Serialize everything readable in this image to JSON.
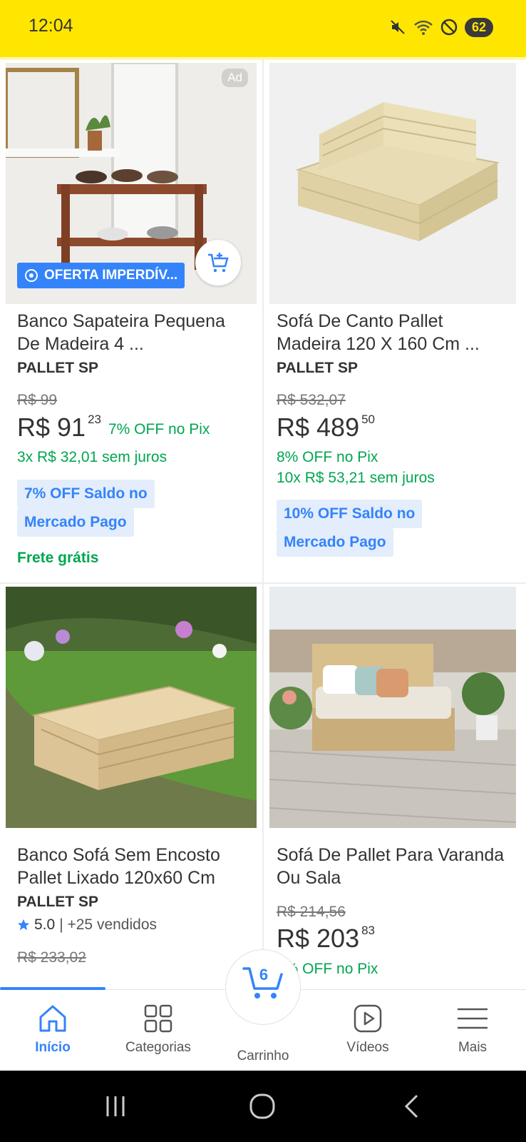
{
  "status_bar": {
    "time": "12:04",
    "battery": "62"
  },
  "products": [
    {
      "ad": "Ad",
      "offer_badge": "OFERTA IMPERDÍV...",
      "title": "Banco Sapateira Pequena De Madeira 4 ...",
      "brand": "PALLET SP",
      "old_price": "R$ 99",
      "price_int": "R$ 91",
      "price_cents": "23",
      "pix_discount": "7% OFF no Pix",
      "installments": "3x R$ 32,01 sem juros",
      "promo_line1": "7% OFF Saldo no",
      "promo_line2": "Mercado Pago",
      "shipping": "Frete grátis"
    },
    {
      "title": "Sofá De Canto Pallet Madeira 120 X 160 Cm ...",
      "brand": "PALLET SP",
      "old_price": "R$ 532,07",
      "price_int": "R$ 489",
      "price_cents": "50",
      "pix_discount": "8% OFF no Pix",
      "installments": "10x R$ 53,21 sem juros",
      "promo_line1": "10% OFF Saldo no",
      "promo_line2": "Mercado Pago"
    },
    {
      "title": "Banco Sofá Sem Encosto Pallet Lixado 120x60 Cm",
      "brand": "PALLET SP",
      "rating": "5.0",
      "sold": "| +25 vendidos",
      "old_price": "R$ 233,02"
    },
    {
      "title": "Sofá De Pallet Para Varanda Ou Sala",
      "old_price": "R$ 214,56",
      "price_int": "R$ 203",
      "price_cents": "83",
      "pix_discount": "5% OFF no Pix"
    }
  ],
  "bottom_nav": {
    "home": "Início",
    "categories": "Categorias",
    "cart": "Carrinho",
    "cart_count": "6",
    "videos": "Vídeos",
    "more": "Mais"
  },
  "colors": {
    "brand_yellow": "#ffe600",
    "accent_blue": "#3483fa",
    "discount_green": "#00a650"
  },
  "icons": [
    "mute-icon",
    "wifi-icon",
    "dnd-icon",
    "battery-icon",
    "add-to-cart-icon",
    "home-icon",
    "categories-icon",
    "cart-icon",
    "videos-icon",
    "menu-icon",
    "star-icon"
  ]
}
